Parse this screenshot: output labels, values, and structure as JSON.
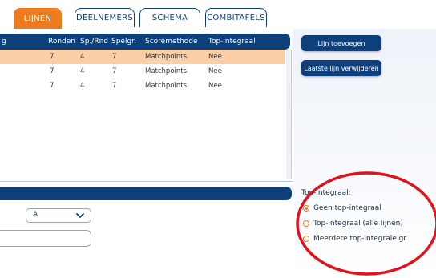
{
  "tabs": [
    {
      "label": "LIJNEN",
      "active": true
    },
    {
      "label": "DEELNEMERS",
      "active": false
    },
    {
      "label": "SCHEMA",
      "active": false
    },
    {
      "label": "COMBITAFELS",
      "active": false
    }
  ],
  "table": {
    "columns": [
      "g",
      "Ronden",
      "Sp./Rnd",
      "Spelgr.",
      "Scoremethode",
      "Top-integraal"
    ],
    "rows": [
      {
        "ronden": "7",
        "sp_rnd": "4",
        "spelgr": "7",
        "scoremethode": "Matchpoints",
        "top_integraal": "Nee",
        "selected": true
      },
      {
        "ronden": "7",
        "sp_rnd": "4",
        "spelgr": "7",
        "scoremethode": "Matchpoints",
        "top_integraal": "Nee",
        "selected": false
      },
      {
        "ronden": "7",
        "sp_rnd": "4",
        "spelgr": "7",
        "scoremethode": "Matchpoints",
        "top_integraal": "Nee",
        "selected": false
      }
    ]
  },
  "buttons": {
    "add_line": "Lijn toevoegen",
    "remove_last_line": "Laatste lijn verwijderen"
  },
  "form": {
    "select_value": "A",
    "text_value": ""
  },
  "top_integraal": {
    "label": "Top-integraal:",
    "options": [
      {
        "label": "Geen top-integraal",
        "checked": true
      },
      {
        "label": "Top-integraal (alle lijnen)",
        "checked": false
      },
      {
        "label": "Meerdere top-integrale gr",
        "checked": false
      }
    ]
  },
  "colors": {
    "navy": "#0d3f7a",
    "orange": "#ee7b1e",
    "selected_row": "#fbcfa5",
    "annotation_red": "#e0121b"
  }
}
